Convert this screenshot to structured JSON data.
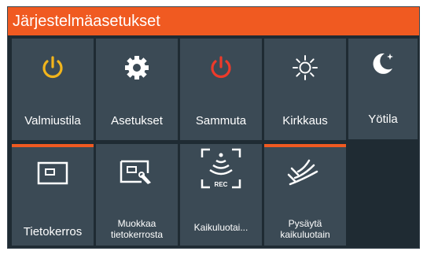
{
  "window": {
    "title": "Järjestelmäasetukset"
  },
  "tiles": [
    {
      "label": "Valmiustila",
      "icon": "power-icon",
      "icon_color": "#f2b51c"
    },
    {
      "label": "Asetukset",
      "icon": "gear-icon",
      "icon_color": "#ffffff"
    },
    {
      "label": "Sammuta",
      "icon": "power-icon",
      "icon_color": "#ee3a2a"
    },
    {
      "label": "Kirkkaus",
      "icon": "sun-icon",
      "icon_color": "#ffffff"
    },
    {
      "label": "Yötila",
      "icon": "moon-icon",
      "icon_color": "#ffffff"
    },
    {
      "label": "Tietokerros",
      "icon": "data-overlay-icon",
      "icon_color": "#ffffff",
      "active": true
    },
    {
      "label": "Muokkaa tietokerrosta",
      "icon": "edit-overlay-icon",
      "icon_color": "#ffffff"
    },
    {
      "label": "Kaikuluotai...",
      "icon": "sonar-record-icon",
      "icon_color": "#ffffff",
      "icon_text": "REC"
    },
    {
      "label": "Pysäytä kaikuluotain",
      "icon": "pause-sonar-icon",
      "icon_color": "#ffffff",
      "active": true
    }
  ],
  "colors": {
    "accent": "#f05a21",
    "tile_bg": "#3b4a55",
    "panel_bg": "#1f2b33"
  }
}
